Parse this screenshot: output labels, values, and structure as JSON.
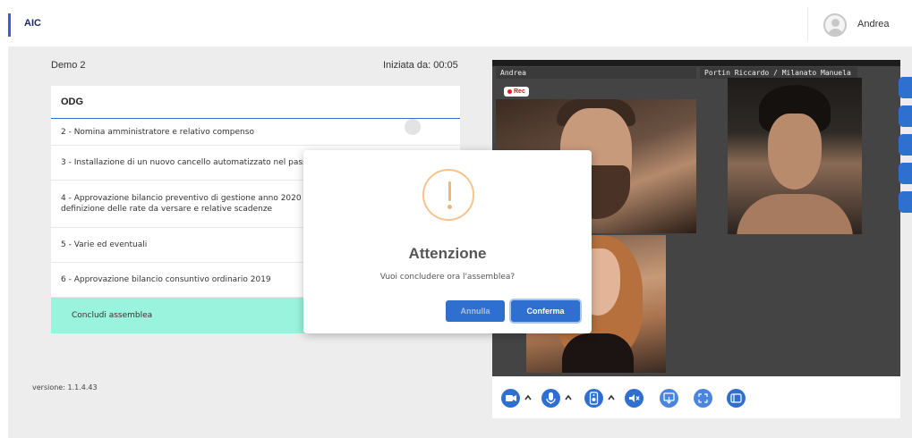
{
  "header": {
    "brand": "AIC",
    "user_name": "Andrea"
  },
  "meeting": {
    "name": "Demo 2",
    "started": "Iniziata da: 00:05"
  },
  "odg": {
    "title": "ODG",
    "items": [
      "2 - Nomina amministratore e relativo compenso",
      "3 - Installazione di un nuovo cancello automatizzato nel passo",
      "4 - Approvazione bilancio preventivo di gestione anno 2020 e",
      "definizione delle rate da versare e relative scadenze",
      "5 - Varie ed eventuali",
      "6 - Approvazione bilancio consuntivo ordinario 2019"
    ],
    "end_label": "Concludi assemblea"
  },
  "version": "versione: 1.1.4.43",
  "video": {
    "participants": [
      "Andrea",
      "Portin Riccardo / Milanato Manuela"
    ],
    "rec_label": "Rec"
  },
  "controls": {
    "icons": [
      "camera-icon",
      "microphone-icon",
      "speaker-icon",
      "mute-audio-icon",
      "share-screen-icon",
      "fullscreen-icon",
      "layout-icon"
    ]
  },
  "modal": {
    "title": "Attenzione",
    "message": "Vuoi concludere ora l'assemblea?",
    "cancel": "Annulla",
    "confirm": "Conferma"
  },
  "colors": {
    "accent": "#2f6fd0",
    "warning": "#f0b577",
    "highlight_row": "#9af3dc"
  }
}
